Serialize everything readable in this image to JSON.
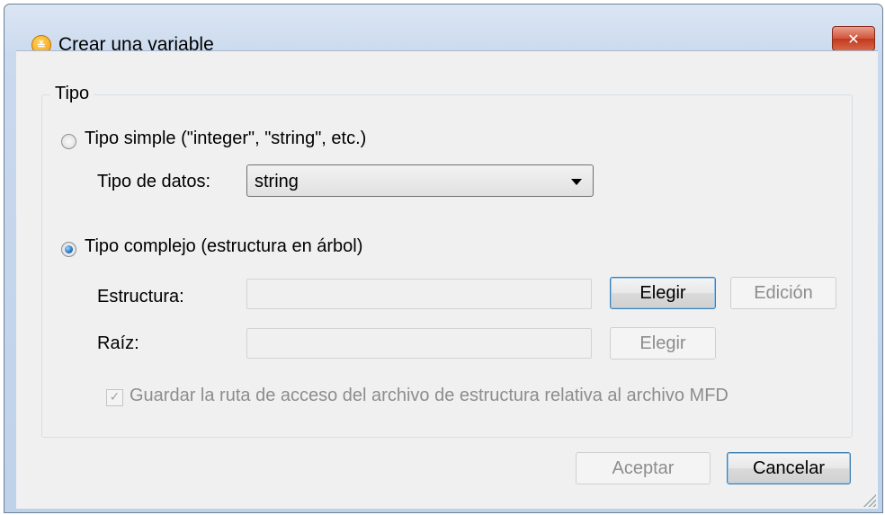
{
  "window": {
    "title": "Crear una variable",
    "app_icon_glyph": "≚",
    "close_glyph": "✕"
  },
  "type_group": {
    "legend": "Tipo",
    "simple": {
      "label": "Tipo simple (\"integer\", \"string\", etc.)",
      "selected": false,
      "data_type_label": "Tipo de datos:",
      "data_type_value": "string"
    },
    "complex": {
      "label": "Tipo complejo (estructura en árbol)",
      "selected": true,
      "structure_label": "Estructura:",
      "structure_value": "",
      "choose_label": "Elegir",
      "edit_label": "Edición",
      "root_label": "Raíz:",
      "root_value": "",
      "root_choose_label": "Elegir",
      "save_relative_label": "Guardar la ruta de acceso del archivo de estructura relativa al archivo MFD",
      "save_relative_checked": true
    }
  },
  "footer": {
    "ok_label": "Aceptar",
    "cancel_label": "Cancelar"
  },
  "colors": {
    "frame": "#c9d9ee",
    "client": "#f0f0f0",
    "close": "#c2391d",
    "focus": "#3c7fb1"
  },
  "icons": [
    "app-logo-icon",
    "close-icon",
    "dropdown-arrow-icon",
    "checkmark-icon",
    "resize-grip-icon"
  ]
}
